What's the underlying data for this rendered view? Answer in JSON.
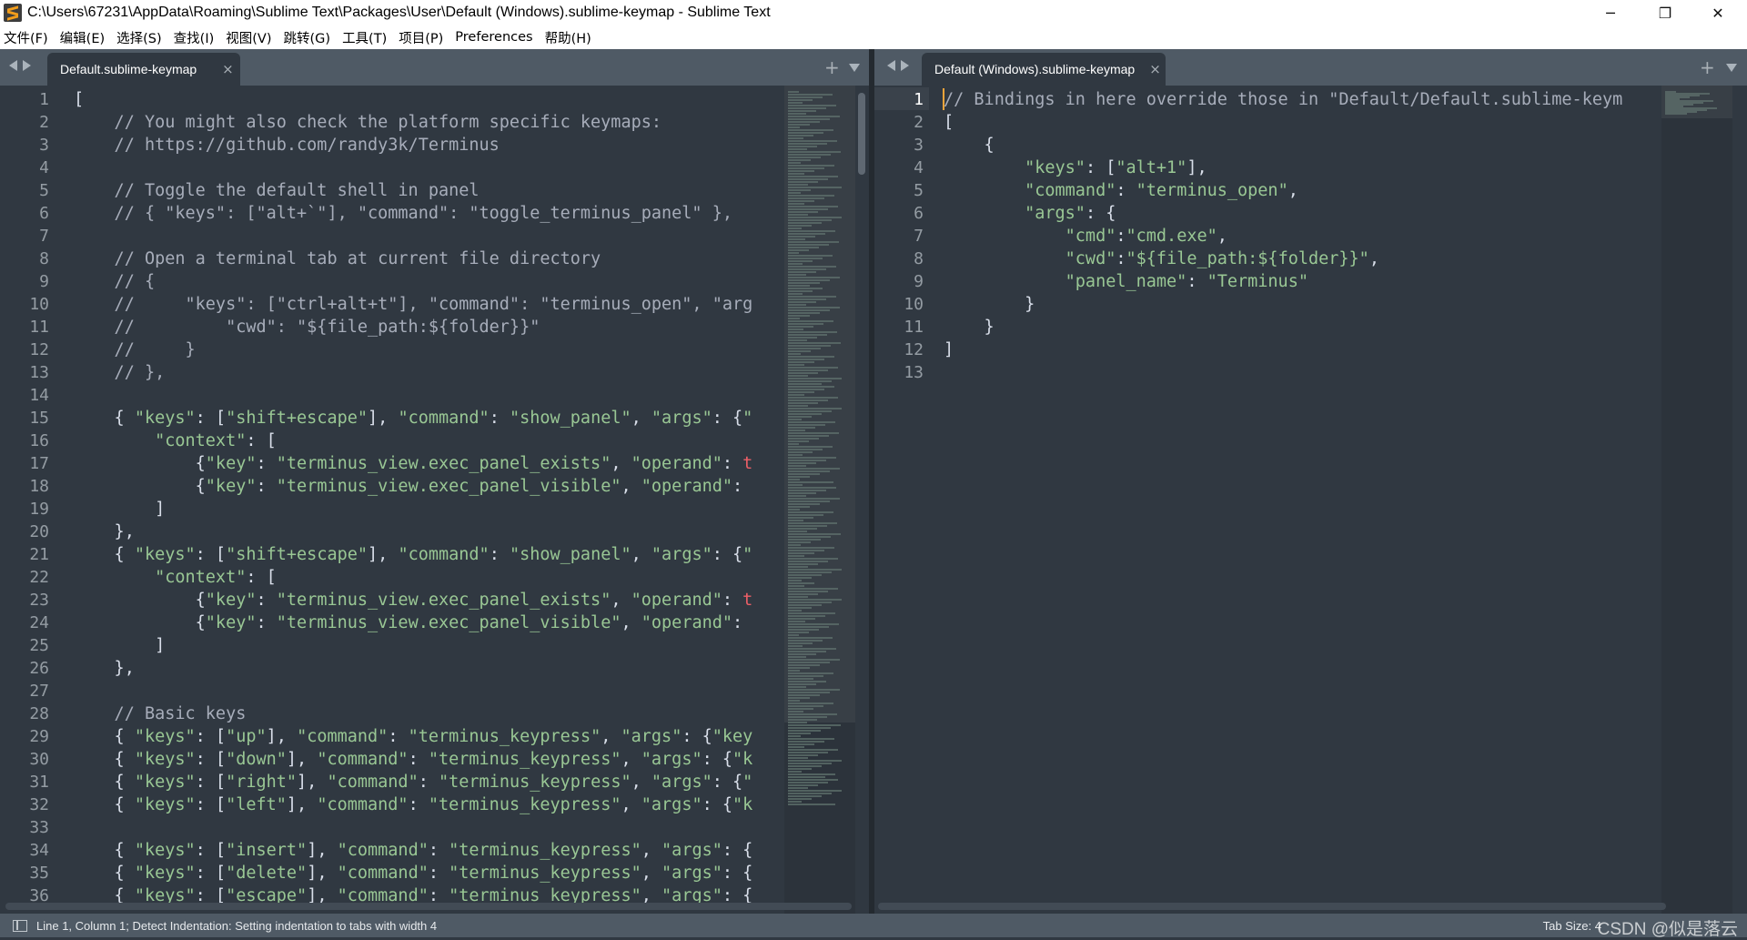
{
  "window": {
    "title": "C:\\Users\\67231\\AppData\\Roaming\\Sublime Text\\Packages\\User\\Default (Windows).sublime-keymap - Sublime Text",
    "minimize_glyph": "─",
    "maximize_glyph": "❐",
    "close_glyph": "✕"
  },
  "menu": [
    "文件(F)",
    "编辑(E)",
    "选择(S)",
    "查找(I)",
    "视图(V)",
    "跳转(G)",
    "工具(T)",
    "项目(P)",
    "Preferences",
    "帮助(H)"
  ],
  "left_pane": {
    "tab_label": "Default.sublime-keymap",
    "close_glyph": "×",
    "plus_glyph": "+",
    "line_numbers": [
      "1",
      "2",
      "3",
      "4",
      "5",
      "6",
      "7",
      "8",
      "9",
      "10",
      "11",
      "12",
      "13",
      "14",
      "15",
      "16",
      "17",
      "18",
      "19",
      "20",
      "21",
      "22",
      "23",
      "24",
      "25",
      "26",
      "27",
      "28",
      "29",
      "30",
      "31",
      "32",
      "33",
      "34",
      "35",
      "36"
    ],
    "lines": [
      [
        [
          "p",
          "["
        ]
      ],
      [
        [
          "c",
          "    // You might also check the platform specific keymaps:"
        ]
      ],
      [
        [
          "c",
          "    // https://github.com/randy3k/Terminus"
        ]
      ],
      [],
      [
        [
          "c",
          "    // Toggle the default shell in panel"
        ]
      ],
      [
        [
          "c",
          "    // { \"keys\": [\"alt+`\"], \"command\": \"toggle_terminus_panel\" },"
        ]
      ],
      [],
      [
        [
          "c",
          "    // Open a terminal tab at current file directory"
        ]
      ],
      [
        [
          "c",
          "    // {"
        ]
      ],
      [
        [
          "c",
          "    //     \"keys\": [\"ctrl+alt+t\"], \"command\": \"terminus_open\", \"arg"
        ]
      ],
      [
        [
          "c",
          "    //         \"cwd\": \"${file_path:${folder}}\""
        ]
      ],
      [
        [
          "c",
          "    //     }"
        ]
      ],
      [
        [
          "c",
          "    // },"
        ]
      ],
      [],
      [
        [
          "p",
          "    { "
        ],
        [
          "s",
          "\"keys\""
        ],
        [
          "p",
          ": ["
        ],
        [
          "s",
          "\"shift+escape\""
        ],
        [
          "p",
          "], "
        ],
        [
          "s",
          "\"command\""
        ],
        [
          "p",
          ": "
        ],
        [
          "s",
          "\"show_panel\""
        ],
        [
          "p",
          ", "
        ],
        [
          "s",
          "\"args\""
        ],
        [
          "p",
          ": {"
        ],
        [
          "s",
          "\""
        ]
      ],
      [
        [
          "p",
          "        "
        ],
        [
          "s",
          "\"context\""
        ],
        [
          "p",
          ": ["
        ]
      ],
      [
        [
          "p",
          "            {"
        ],
        [
          "s",
          "\"key\""
        ],
        [
          "p",
          ": "
        ],
        [
          "s",
          "\"terminus_view.exec_panel_exists\""
        ],
        [
          "p",
          ", "
        ],
        [
          "s",
          "\"operand\""
        ],
        [
          "p",
          ": "
        ],
        [
          "r",
          "t"
        ]
      ],
      [
        [
          "p",
          "            {"
        ],
        [
          "s",
          "\"key\""
        ],
        [
          "p",
          ": "
        ],
        [
          "s",
          "\"terminus_view.exec_panel_visible\""
        ],
        [
          "p",
          ", "
        ],
        [
          "s",
          "\"operand\""
        ],
        [
          "p",
          ":"
        ]
      ],
      [
        [
          "p",
          "        ]"
        ]
      ],
      [
        [
          "p",
          "    },"
        ]
      ],
      [
        [
          "p",
          "    { "
        ],
        [
          "s",
          "\"keys\""
        ],
        [
          "p",
          ": ["
        ],
        [
          "s",
          "\"shift+escape\""
        ],
        [
          "p",
          "], "
        ],
        [
          "s",
          "\"command\""
        ],
        [
          "p",
          ": "
        ],
        [
          "s",
          "\"show_panel\""
        ],
        [
          "p",
          ", "
        ],
        [
          "s",
          "\"args\""
        ],
        [
          "p",
          ": {"
        ],
        [
          "s",
          "\""
        ]
      ],
      [
        [
          "p",
          "        "
        ],
        [
          "s",
          "\"context\""
        ],
        [
          "p",
          ": ["
        ]
      ],
      [
        [
          "p",
          "            {"
        ],
        [
          "s",
          "\"key\""
        ],
        [
          "p",
          ": "
        ],
        [
          "s",
          "\"terminus_view.exec_panel_exists\""
        ],
        [
          "p",
          ", "
        ],
        [
          "s",
          "\"operand\""
        ],
        [
          "p",
          ": "
        ],
        [
          "r",
          "t"
        ]
      ],
      [
        [
          "p",
          "            {"
        ],
        [
          "s",
          "\"key\""
        ],
        [
          "p",
          ": "
        ],
        [
          "s",
          "\"terminus_view.exec_panel_visible\""
        ],
        [
          "p",
          ", "
        ],
        [
          "s",
          "\"operand\""
        ],
        [
          "p",
          ":"
        ]
      ],
      [
        [
          "p",
          "        ]"
        ]
      ],
      [
        [
          "p",
          "    },"
        ]
      ],
      [],
      [
        [
          "c",
          "    // Basic keys"
        ]
      ],
      [
        [
          "p",
          "    { "
        ],
        [
          "s",
          "\"keys\""
        ],
        [
          "p",
          ": ["
        ],
        [
          "s",
          "\"up\""
        ],
        [
          "p",
          "], "
        ],
        [
          "s",
          "\"command\""
        ],
        [
          "p",
          ": "
        ],
        [
          "s",
          "\"terminus_keypress\""
        ],
        [
          "p",
          ", "
        ],
        [
          "s",
          "\"args\""
        ],
        [
          "p",
          ": {"
        ],
        [
          "s",
          "\"key"
        ]
      ],
      [
        [
          "p",
          "    { "
        ],
        [
          "s",
          "\"keys\""
        ],
        [
          "p",
          ": ["
        ],
        [
          "s",
          "\"down\""
        ],
        [
          "p",
          "], "
        ],
        [
          "s",
          "\"command\""
        ],
        [
          "p",
          ": "
        ],
        [
          "s",
          "\"terminus_keypress\""
        ],
        [
          "p",
          ", "
        ],
        [
          "s",
          "\"args\""
        ],
        [
          "p",
          ": {"
        ],
        [
          "s",
          "\"k"
        ]
      ],
      [
        [
          "p",
          "    { "
        ],
        [
          "s",
          "\"keys\""
        ],
        [
          "p",
          ": ["
        ],
        [
          "s",
          "\"right\""
        ],
        [
          "p",
          "], "
        ],
        [
          "s",
          "\"command\""
        ],
        [
          "p",
          ": "
        ],
        [
          "s",
          "\"terminus_keypress\""
        ],
        [
          "p",
          ", "
        ],
        [
          "s",
          "\"args\""
        ],
        [
          "p",
          ": {"
        ],
        [
          "s",
          "\""
        ]
      ],
      [
        [
          "p",
          "    { "
        ],
        [
          "s",
          "\"keys\""
        ],
        [
          "p",
          ": ["
        ],
        [
          "s",
          "\"left\""
        ],
        [
          "p",
          "], "
        ],
        [
          "s",
          "\"command\""
        ],
        [
          "p",
          ": "
        ],
        [
          "s",
          "\"terminus_keypress\""
        ],
        [
          "p",
          ", "
        ],
        [
          "s",
          "\"args\""
        ],
        [
          "p",
          ": {"
        ],
        [
          "s",
          "\"k"
        ]
      ],
      [],
      [
        [
          "p",
          "    { "
        ],
        [
          "s",
          "\"keys\""
        ],
        [
          "p",
          ": ["
        ],
        [
          "s",
          "\"insert\""
        ],
        [
          "p",
          "], "
        ],
        [
          "s",
          "\"command\""
        ],
        [
          "p",
          ": "
        ],
        [
          "s",
          "\"terminus_keypress\""
        ],
        [
          "p",
          ", "
        ],
        [
          "s",
          "\"args\""
        ],
        [
          "p",
          ": {"
        ]
      ],
      [
        [
          "p",
          "    { "
        ],
        [
          "s",
          "\"keys\""
        ],
        [
          "p",
          ": ["
        ],
        [
          "s",
          "\"delete\""
        ],
        [
          "p",
          "], "
        ],
        [
          "s",
          "\"command\""
        ],
        [
          "p",
          ": "
        ],
        [
          "s",
          "\"terminus_keypress\""
        ],
        [
          "p",
          ", "
        ],
        [
          "s",
          "\"args\""
        ],
        [
          "p",
          ": {"
        ]
      ],
      [
        [
          "p",
          "    { "
        ],
        [
          "s",
          "\"keys\""
        ],
        [
          "p",
          ": ["
        ],
        [
          "s",
          "\"escape\""
        ],
        [
          "p",
          "], "
        ],
        [
          "s",
          "\"command\""
        ],
        [
          "p",
          ": "
        ],
        [
          "s",
          "\"terminus_keypress\""
        ],
        [
          "p",
          ", "
        ],
        [
          "s",
          "\"args\""
        ],
        [
          "p",
          ": {"
        ]
      ]
    ]
  },
  "right_pane": {
    "tab_label": "Default (Windows).sublime-keymap",
    "close_glyph": "×",
    "plus_glyph": "+",
    "line_numbers": [
      "1",
      "2",
      "3",
      "4",
      "5",
      "6",
      "7",
      "8",
      "9",
      "10",
      "11",
      "12",
      "13"
    ],
    "active_line": 1,
    "lines": [
      [
        [
          "c",
          "// Bindings in here override those in \"Default/Default.sublime-keym"
        ]
      ],
      [
        [
          "p",
          "["
        ]
      ],
      [
        [
          "p",
          "    {"
        ]
      ],
      [
        [
          "p",
          "        "
        ],
        [
          "s",
          "\"keys\""
        ],
        [
          "p",
          ": ["
        ],
        [
          "s",
          "\"alt+1\""
        ],
        [
          "p",
          "],"
        ]
      ],
      [
        [
          "p",
          "        "
        ],
        [
          "s",
          "\"command\""
        ],
        [
          "p",
          ": "
        ],
        [
          "s",
          "\"terminus_open\""
        ],
        [
          "p",
          ","
        ]
      ],
      [
        [
          "p",
          "        "
        ],
        [
          "s",
          "\"args\""
        ],
        [
          "p",
          ": {"
        ]
      ],
      [
        [
          "p",
          "            "
        ],
        [
          "s",
          "\"cmd\""
        ],
        [
          "p",
          ":"
        ],
        [
          "s",
          "\"cmd.exe\""
        ],
        [
          "p",
          ","
        ]
      ],
      [
        [
          "p",
          "            "
        ],
        [
          "s",
          "\"cwd\""
        ],
        [
          "p",
          ":"
        ],
        [
          "s",
          "\"${file_path:${folder}}\""
        ],
        [
          "p",
          ","
        ]
      ],
      [
        [
          "p",
          "            "
        ],
        [
          "s",
          "\"panel_name\""
        ],
        [
          "p",
          ": "
        ],
        [
          "s",
          "\"Terminus\""
        ]
      ],
      [
        [
          "p",
          "        }"
        ]
      ],
      [
        [
          "p",
          "    }"
        ]
      ],
      [
        [
          "p",
          "]"
        ]
      ],
      []
    ]
  },
  "status": {
    "text": "Line 1, Column 1; Detect Indentation: Setting indentation to tabs with width 4",
    "tab_size": "Tab Size: 4",
    "watermark": "CSDN @似是落云"
  },
  "colors": {
    "background": "#303841",
    "tabbar": "#4f5a65",
    "string": "#99c794",
    "comment": "#a7adba",
    "cursor": "#f0a43a"
  }
}
